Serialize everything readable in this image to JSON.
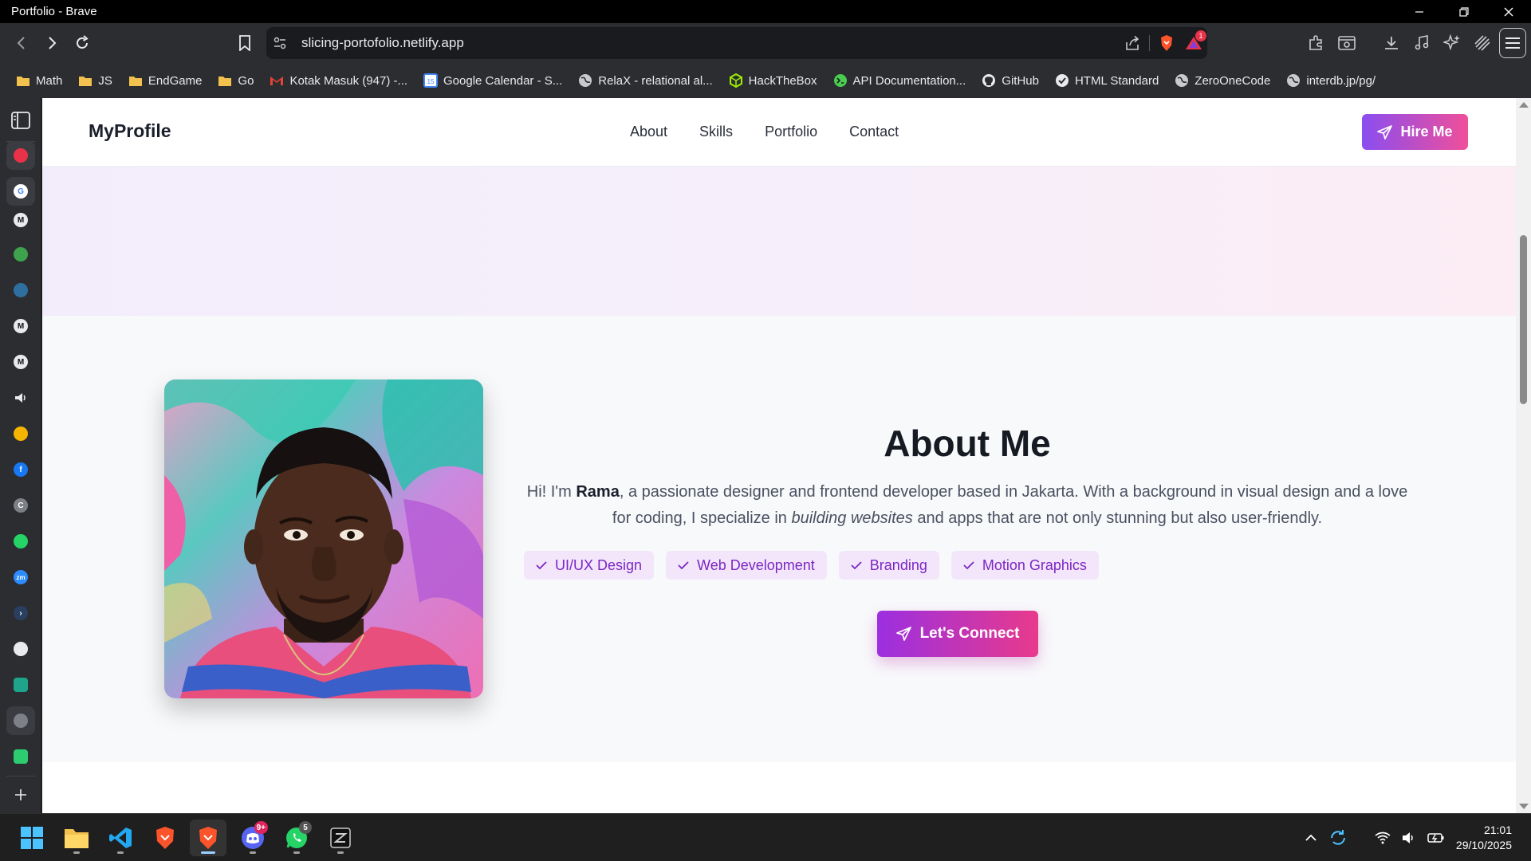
{
  "window": {
    "title": "Portfolio - Brave"
  },
  "toolbar": {
    "url": "slicing-portofolio.netlify.app",
    "alert_count": "1"
  },
  "bookmarks": [
    {
      "label": "Math",
      "icon": "folder-icon"
    },
    {
      "label": "JS",
      "icon": "folder-icon"
    },
    {
      "label": "EndGame",
      "icon": "folder-icon"
    },
    {
      "label": "Go",
      "icon": "folder-icon"
    },
    {
      "label": "Kotak Masuk (947) -...",
      "icon": "gmail-icon"
    },
    {
      "label": "Google Calendar - S...",
      "icon": "calendar-icon"
    },
    {
      "label": "RelaX - relational al...",
      "icon": "globe-icon"
    },
    {
      "label": "HackTheBox",
      "icon": "hackthebox-icon"
    },
    {
      "label": "API Documentation...",
      "icon": "api-icon"
    },
    {
      "label": "GitHub",
      "icon": "github-icon"
    },
    {
      "label": "HTML Standard",
      "icon": "html-standard-icon"
    },
    {
      "label": "ZeroOneCode",
      "icon": "globe-icon"
    },
    {
      "label": "interdb.jp/pg/",
      "icon": "globe-icon"
    }
  ],
  "site": {
    "brand": "MyProfile",
    "nav": [
      "About",
      "Skills",
      "Portfolio",
      "Contact"
    ],
    "hire_label": "Hire Me",
    "about": {
      "title": "About Me",
      "text_intro": "Hi! I'm ",
      "text_name": "Rama",
      "text_mid": ", a passionate designer and frontend developer based in Jakarta. With a background in visual design and a love for coding, I specialize in ",
      "text_em": "building websites",
      "text_end": " and apps that are not only stunning but also user-friendly.",
      "tags": [
        "UI/UX Design",
        "Web Development",
        "Branding",
        "Motion Graphics"
      ],
      "cta": "Let's Connect"
    }
  },
  "taskbar": {
    "discord_badge": "9+",
    "whatsapp_badge": "5",
    "time": "21:01",
    "date": "29/10/2025"
  },
  "colors": {
    "accent_purple": "#8a4ef0",
    "accent_pink": "#ef4f9a",
    "tag_bg": "#f3e6fb",
    "tag_text": "#7b27c4"
  }
}
